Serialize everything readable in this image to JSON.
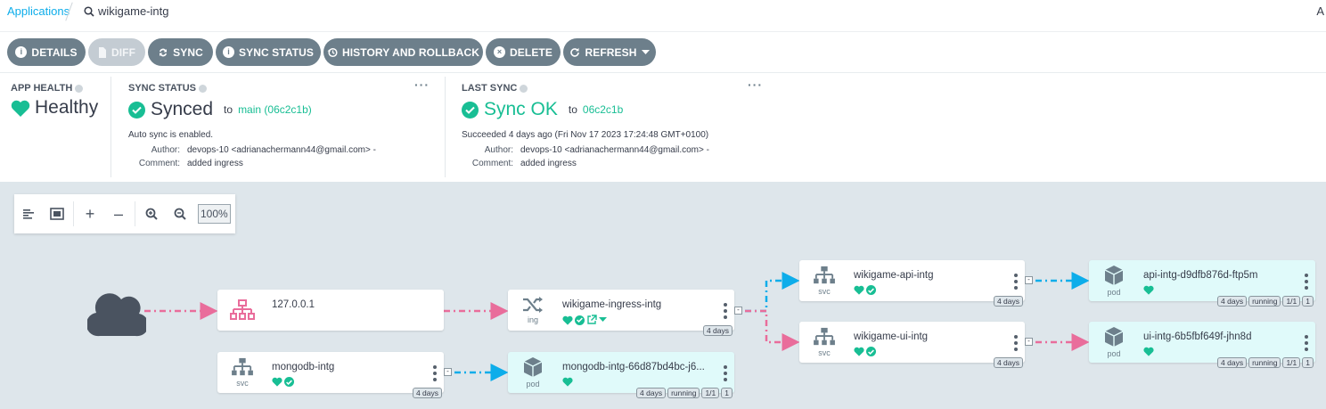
{
  "breadcrumb": {
    "applications": "Applications",
    "app_name": "wikigame-intg",
    "right_initial": "A"
  },
  "toolbar": {
    "details": "DETAILS",
    "diff": "DIFF",
    "sync": "SYNC",
    "sync_status": "SYNC STATUS",
    "history": "HISTORY AND ROLLBACK",
    "delete": "DELETE",
    "refresh": "REFRESH"
  },
  "app_health": {
    "label": "APP HEALTH",
    "value": "Healthy"
  },
  "sync_status": {
    "label": "SYNC STATUS",
    "value": "Synced",
    "to": "to",
    "revision": "main (06c2c1b)",
    "auto_sync": "Auto sync is enabled.",
    "author_label": "Author:",
    "author": "devops-10 <adrianachermann44@gmail.com> -",
    "comment_label": "Comment:",
    "comment": "added ingress"
  },
  "last_sync": {
    "label": "LAST SYNC",
    "value": "Sync OK",
    "to": "to",
    "revision": "06c2c1b",
    "succeeded": "Succeeded 4 days ago (Fri Nov 17 2023 17:24:48 GMT+0100)",
    "author_label": "Author:",
    "author": "devops-10 <adrianachermann44@gmail.com> -",
    "comment_label": "Comment:",
    "comment": "added ingress"
  },
  "zoom": {
    "level": "100%"
  },
  "nodes": {
    "ip": {
      "name": "127.0.0.1"
    },
    "ingress": {
      "name": "wikigame-ingress-intg",
      "kind": "ing",
      "age": "4 days"
    },
    "mongo_svc": {
      "name": "mongodb-intg",
      "kind": "svc",
      "age": "4 days"
    },
    "mongo_pod": {
      "name": "mongodb-intg-66d87bd4bc-j6...",
      "kind": "pod",
      "age": "4 days",
      "status": "running",
      "ready": "1/1",
      "restarts": "1"
    },
    "api_svc": {
      "name": "wikigame-api-intg",
      "kind": "svc",
      "age": "4 days"
    },
    "ui_svc": {
      "name": "wikigame-ui-intg",
      "kind": "svc",
      "age": "4 days"
    },
    "api_pod": {
      "name": "api-intg-d9dfb876d-ftp5m",
      "kind": "pod",
      "age": "4 days",
      "status": "running",
      "ready": "1/1",
      "restarts": "1"
    },
    "ui_pod": {
      "name": "ui-intg-6b5fbf649f-jhn8d",
      "kind": "pod",
      "age": "4 days",
      "status": "running",
      "ready": "1/1",
      "restarts": "1"
    }
  },
  "colors": {
    "healthy": "#18be94",
    "edge_pink": "#e96d9b",
    "edge_blue": "#0dadea",
    "button": "#6d7f8b"
  }
}
